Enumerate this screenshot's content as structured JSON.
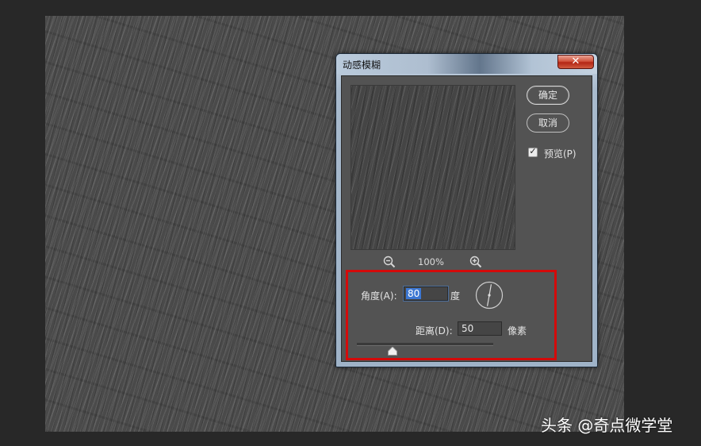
{
  "dialog": {
    "title": "动感模糊",
    "close_symbol": "✕",
    "ok_label": "确定",
    "cancel_label": "取消",
    "preview_label": "预览(P)",
    "preview_checked": true,
    "zoom_level": "100%",
    "angle": {
      "label": "角度(A):",
      "value": "80",
      "unit": "度"
    },
    "distance": {
      "label": "距离(D):",
      "value": "50",
      "unit": "像素",
      "slider_fraction": 0.26
    }
  },
  "icons": {
    "close": "close-icon",
    "zoom_out": "zoom-out-icon",
    "zoom_in": "zoom-in-icon",
    "check": "check-icon",
    "angle_dial": "angle-dial-icon",
    "slider_thumb": "slider-thumb-icon"
  },
  "colors": {
    "highlight": "#d40a0a",
    "selection": "#3c77d3",
    "panel": "#535353",
    "canvas": "#4a4a4a"
  },
  "watermark": "头条 @奇点微学堂"
}
